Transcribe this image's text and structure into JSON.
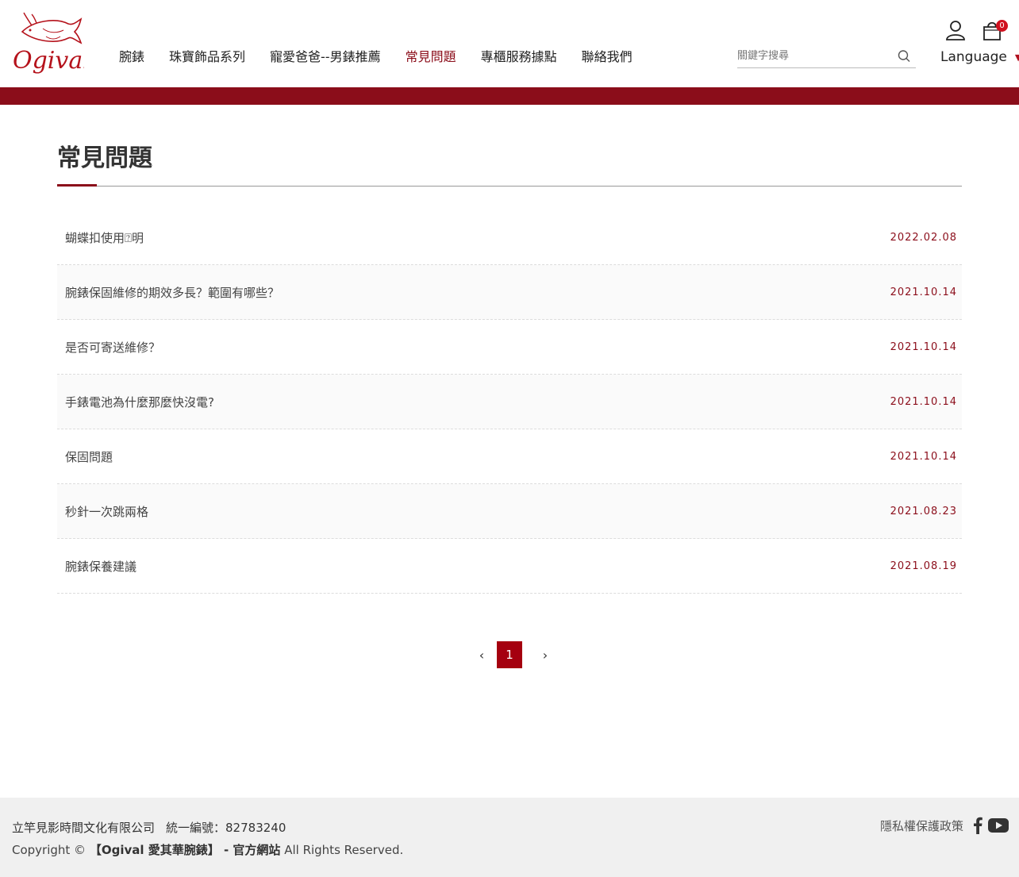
{
  "header": {
    "logo_text": "Ogival",
    "nav": [
      {
        "label": "腕錶",
        "active": false
      },
      {
        "label": "珠寶飾品系列",
        "active": false
      },
      {
        "label": "寵愛爸爸--男錶推薦",
        "active": false
      },
      {
        "label": "常見問題",
        "active": true
      },
      {
        "label": "專櫃服務據點",
        "active": false
      },
      {
        "label": "聯絡我們",
        "active": false
      }
    ],
    "search_placeholder": "關鍵字搜尋",
    "cart_count": "0",
    "language_label": "Language"
  },
  "main": {
    "page_title": "常見問題",
    "faq": [
      {
        "question": "蝴蝶扣使用⍰明",
        "date": "2022.02.08"
      },
      {
        "question": "腕錶保固維修的期效多長？範圍有哪些？",
        "date": "2021.10.14"
      },
      {
        "question": "是否可寄送維修？",
        "date": "2021.10.14"
      },
      {
        "question": "手錶電池為什麼那麼快沒電?",
        "date": "2021.10.14"
      },
      {
        "question": "保固問題",
        "date": "2021.10.14"
      },
      {
        "question": "秒針一次跳兩格",
        "date": "2021.08.23"
      },
      {
        "question": "腕錶保養建議",
        "date": "2021.08.19"
      }
    ],
    "pagination": {
      "prev": "‹",
      "current": "1",
      "next": "›"
    }
  },
  "footer": {
    "company": "立竿見影時間文化有限公司",
    "tax_id": "統一編號：82783240",
    "copyright_prefix": "Copyright ©",
    "copyright_site": "【Ogival 愛其華腕錶】 - 官方網站",
    "copyright_suffix": "All Rights Reserved.",
    "privacy": "隱私權保護政策"
  },
  "colors": {
    "brand": "#8b0d1a",
    "page_active": "#a5000f",
    "badge": "#d0101e",
    "footer_bg": "#f0f0f0"
  },
  "icons": [
    "ogival-fish-logo",
    "search-icon",
    "user-icon",
    "cart-icon",
    "caret-down-icon",
    "chevron-left-icon",
    "chevron-right-icon",
    "facebook-icon",
    "youtube-icon"
  ]
}
